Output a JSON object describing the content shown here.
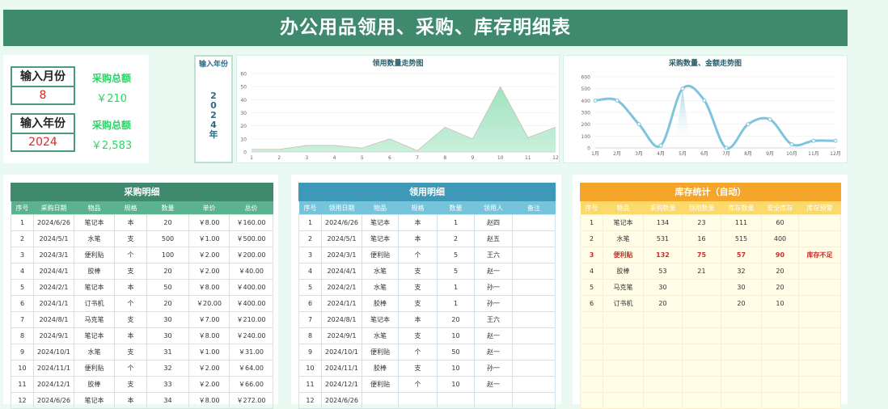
{
  "title": "办公用品领用、采购、库存明细表",
  "kpi": {
    "month_label": "输入月份",
    "month_value": "8",
    "month_total_label": "采购总额",
    "month_total_value": "￥210",
    "year_label": "输入年份",
    "year_value": "2024",
    "year_total_label": "采购总额",
    "year_total_value": "￥2,583"
  },
  "year_panel": {
    "title": "输入年份",
    "value": [
      "2",
      "0",
      "2",
      "4",
      "年"
    ]
  },
  "chart_data": [
    {
      "type": "area",
      "title": "领用数量走势图",
      "x": [
        "1",
        "2",
        "3",
        "4",
        "5",
        "6",
        "7",
        "8",
        "9",
        "10",
        "11",
        "12"
      ],
      "y_ticks": [
        "0",
        "10",
        "20",
        "30",
        "40",
        "50",
        "60"
      ],
      "ylim": [
        0,
        60
      ],
      "series": [
        {
          "values": [
            2,
            2,
            5,
            5,
            3,
            10,
            1,
            19,
            10,
            50,
            11,
            19
          ]
        }
      ],
      "color": "#9fe3bf"
    },
    {
      "type": "line",
      "title": "采购数量、金额走势图",
      "x": [
        "1月",
        "2月",
        "3月",
        "4月",
        "5月",
        "6月",
        "7月",
        "8月",
        "9月",
        "10月",
        "11月",
        "12月"
      ],
      "y_ticks": [
        "0",
        "100",
        "200",
        "300",
        "400",
        "500",
        "600"
      ],
      "ylim": [
        0,
        600
      ],
      "series": [
        {
          "values": [
            400,
            400,
            200,
            20,
            500,
            400,
            0,
            200,
            240,
            30,
            60,
            60
          ]
        }
      ],
      "color": "#7fc4dd"
    }
  ],
  "purchase": {
    "title": "采购明细",
    "headers": [
      "序号",
      "采购日期",
      "物品",
      "规格",
      "数量",
      "单价",
      "总价"
    ],
    "rows": [
      [
        "1",
        "2024/6/26",
        "笔记本",
        "本",
        "20",
        "￥8.00",
        "￥160.00"
      ],
      [
        "2",
        "2024/5/1",
        "水笔",
        "支",
        "500",
        "￥1.00",
        "￥500.00"
      ],
      [
        "3",
        "2024/3/1",
        "便利贴",
        "个",
        "100",
        "￥2.00",
        "￥200.00"
      ],
      [
        "4",
        "2024/4/1",
        "胶棒",
        "支",
        "20",
        "￥2.00",
        "￥40.00"
      ],
      [
        "5",
        "2024/2/1",
        "笔记本",
        "本",
        "50",
        "￥8.00",
        "￥400.00"
      ],
      [
        "6",
        "2024/1/1",
        "订书机",
        "个",
        "20",
        "￥20.00",
        "￥400.00"
      ],
      [
        "7",
        "2024/8/1",
        "马克笔",
        "支",
        "30",
        "￥7.00",
        "￥210.00"
      ],
      [
        "8",
        "2024/9/1",
        "笔记本",
        "本",
        "30",
        "￥8.00",
        "￥240.00"
      ],
      [
        "9",
        "2024/10/1",
        "水笔",
        "支",
        "31",
        "￥1.00",
        "￥31.00"
      ],
      [
        "10",
        "2024/11/1",
        "便利贴",
        "个",
        "32",
        "￥2.00",
        "￥64.00"
      ],
      [
        "11",
        "2024/12/1",
        "胶棒",
        "支",
        "33",
        "￥2.00",
        "￥66.00"
      ],
      [
        "12",
        "2024/6/26",
        "笔记本",
        "本",
        "34",
        "￥8.00",
        "￥272.00"
      ]
    ]
  },
  "usage": {
    "title": "领用明细",
    "headers": [
      "序号",
      "领用日期",
      "物品",
      "规格",
      "数量",
      "领用人",
      "备注"
    ],
    "rows": [
      [
        "1",
        "2024/6/26",
        "笔记本",
        "本",
        "1",
        "赵四",
        ""
      ],
      [
        "2",
        "2024/5/1",
        "笔记本",
        "本",
        "2",
        "赵五",
        ""
      ],
      [
        "3",
        "2024/3/1",
        "便利贴",
        "个",
        "5",
        "王六",
        ""
      ],
      [
        "4",
        "2024/4/1",
        "水笔",
        "支",
        "5",
        "赵一",
        ""
      ],
      [
        "5",
        "2024/2/1",
        "水笔",
        "支",
        "1",
        "孙一",
        ""
      ],
      [
        "6",
        "2024/1/1",
        "胶棒",
        "支",
        "1",
        "孙一",
        ""
      ],
      [
        "7",
        "2024/8/1",
        "笔记本",
        "本",
        "20",
        "王六",
        ""
      ],
      [
        "8",
        "2024/9/1",
        "水笔",
        "支",
        "10",
        "赵一",
        ""
      ],
      [
        "9",
        "2024/10/1",
        "便利贴",
        "个",
        "50",
        "赵一",
        ""
      ],
      [
        "10",
        "2024/11/1",
        "胶棒",
        "支",
        "10",
        "孙一",
        ""
      ],
      [
        "11",
        "2024/12/1",
        "便利贴",
        "个",
        "10",
        "赵一",
        ""
      ],
      [
        "12",
        "2024/6/26",
        "",
        "",
        "",
        "",
        ""
      ]
    ]
  },
  "inventory": {
    "title": "库存统计（自动）",
    "headers": [
      "序号",
      "物品",
      "采购数量",
      "领用数量",
      "库存数量",
      "安全库存",
      "库存预警"
    ],
    "rows": [
      [
        "1",
        "笔记本",
        "134",
        "23",
        "111",
        "60",
        ""
      ],
      [
        "2",
        "水笔",
        "531",
        "16",
        "515",
        "400",
        ""
      ],
      [
        "3",
        "便利贴",
        "132",
        "75",
        "57",
        "90",
        "库存不足"
      ],
      [
        "4",
        "胶棒",
        "53",
        "21",
        "32",
        "20",
        ""
      ],
      [
        "5",
        "马克笔",
        "30",
        "",
        "30",
        "20",
        ""
      ],
      [
        "6",
        "订书机",
        "20",
        "",
        "20",
        "10",
        ""
      ],
      [
        "",
        "",
        "",
        "",
        "",
        "",
        ""
      ],
      [
        "",
        "",
        "",
        "",
        "",
        "",
        ""
      ],
      [
        "",
        "",
        "",
        "",
        "",
        "",
        ""
      ],
      [
        "",
        "",
        "",
        "",
        "",
        "",
        ""
      ],
      [
        "",
        "",
        "",
        "",
        "",
        "",
        ""
      ],
      [
        "",
        "",
        "",
        "",
        "",
        "",
        ""
      ]
    ],
    "warn_color": "#d42a2a"
  }
}
